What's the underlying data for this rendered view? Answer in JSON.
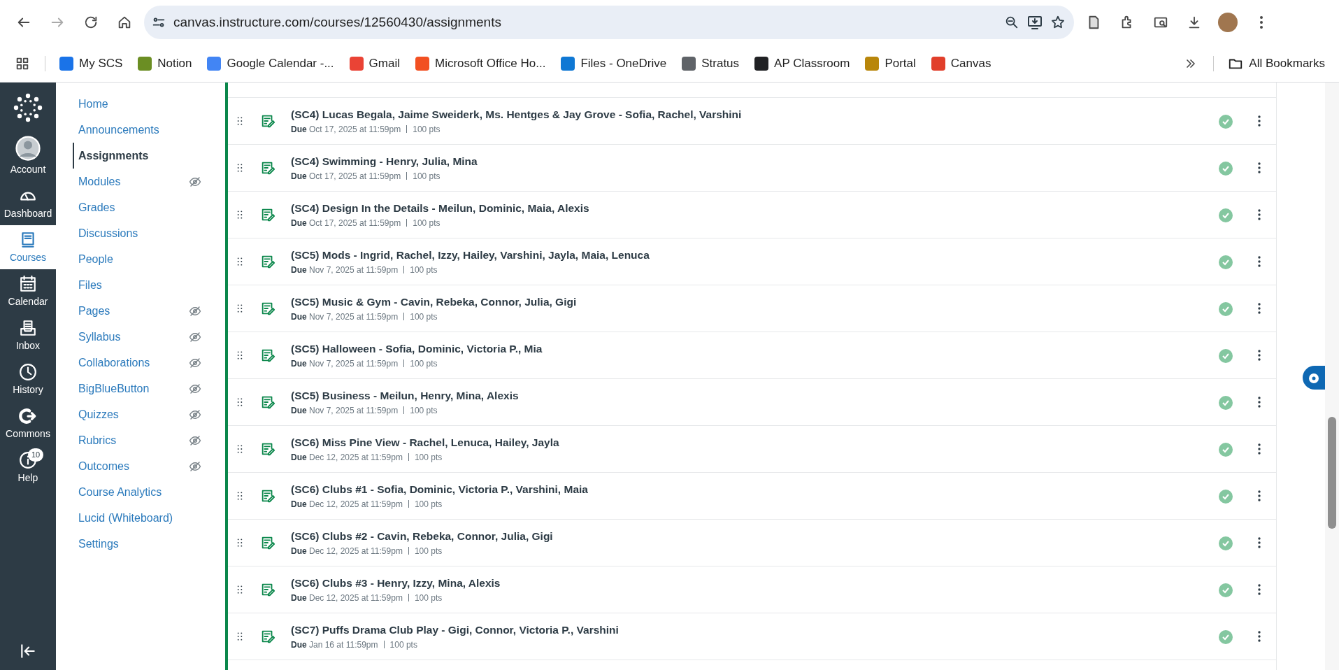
{
  "browser": {
    "url": "canvas.instructure.com/courses/12560430/assignments",
    "bookmarks": [
      {
        "label": "My SCS",
        "color": "#1a73e8"
      },
      {
        "label": "Notion",
        "color": "#6b8e23"
      },
      {
        "label": "Google Calendar -...",
        "color": "#4285f4"
      },
      {
        "label": "Gmail",
        "color": "#ea4335"
      },
      {
        "label": "Microsoft Office Ho...",
        "color": "#f25022"
      },
      {
        "label": "Files - OneDrive",
        "color": "#0f78d4"
      },
      {
        "label": "Stratus",
        "color": "#5f6368"
      },
      {
        "label": "AP Classroom",
        "color": "#202124"
      },
      {
        "label": "Portal",
        "color": "#b8860b"
      },
      {
        "label": "Canvas",
        "color": "#e13f2b"
      }
    ],
    "all_bookmarks": "All Bookmarks"
  },
  "global_nav": [
    {
      "kind": "account",
      "label": "Account",
      "selected": false
    },
    {
      "kind": "dashboard",
      "label": "Dashboard",
      "selected": false
    },
    {
      "kind": "courses",
      "label": "Courses",
      "selected": true
    },
    {
      "kind": "calendar",
      "label": "Calendar",
      "selected": false
    },
    {
      "kind": "inbox",
      "label": "Inbox",
      "selected": false
    },
    {
      "kind": "history",
      "label": "History",
      "selected": false
    },
    {
      "kind": "commons",
      "label": "Commons",
      "selected": false
    },
    {
      "kind": "help",
      "label": "Help",
      "selected": false,
      "badge": "10"
    }
  ],
  "course_nav": [
    {
      "label": "Home",
      "selected": false,
      "hidden": false
    },
    {
      "label": "Announcements",
      "selected": false,
      "hidden": false
    },
    {
      "label": "Assignments",
      "selected": true,
      "hidden": false
    },
    {
      "label": "Modules",
      "selected": false,
      "hidden": true
    },
    {
      "label": "Grades",
      "selected": false,
      "hidden": false
    },
    {
      "label": "Discussions",
      "selected": false,
      "hidden": false
    },
    {
      "label": "People",
      "selected": false,
      "hidden": false
    },
    {
      "label": "Files",
      "selected": false,
      "hidden": false
    },
    {
      "label": "Pages",
      "selected": false,
      "hidden": true
    },
    {
      "label": "Syllabus",
      "selected": false,
      "hidden": true
    },
    {
      "label": "Collaborations",
      "selected": false,
      "hidden": true
    },
    {
      "label": "BigBlueButton",
      "selected": false,
      "hidden": true
    },
    {
      "label": "Quizzes",
      "selected": false,
      "hidden": true
    },
    {
      "label": "Rubrics",
      "selected": false,
      "hidden": true
    },
    {
      "label": "Outcomes",
      "selected": false,
      "hidden": true
    },
    {
      "label": "Course Analytics",
      "selected": false,
      "hidden": false
    },
    {
      "label": "Lucid (Whiteboard)",
      "selected": false,
      "hidden": false
    },
    {
      "label": "Settings",
      "selected": false,
      "hidden": false
    }
  ],
  "assignments": [
    {
      "title": "(SC4) Lucas Begala, Jaime Sweiderk, Ms. Hentges & Jay Grove - Sofia, Rachel, Varshini",
      "due_label": "Due",
      "due": "Oct 17, 2025 at 11:59pm",
      "points": "100 pts",
      "published": true
    },
    {
      "title": "(SC4) Swimming - Henry, Julia, Mina",
      "due_label": "Due",
      "due": "Oct 17, 2025 at 11:59pm",
      "points": "100 pts",
      "published": true
    },
    {
      "title": "(SC4) Design In the Details - Meilun, Dominic, Maia, Alexis",
      "due_label": "Due",
      "due": "Oct 17, 2025 at 11:59pm",
      "points": "100 pts",
      "published": true
    },
    {
      "title": "(SC5) Mods - Ingrid, Rachel, Izzy, Hailey, Varshini, Jayla, Maia, Lenuca",
      "due_label": "Due",
      "due": "Nov 7, 2025 at 11:59pm",
      "points": "100 pts",
      "published": true
    },
    {
      "title": "(SC5) Music & Gym - Cavin, Rebeka, Connor, Julia, Gigi",
      "due_label": "Due",
      "due": "Nov 7, 2025 at 11:59pm",
      "points": "100 pts",
      "published": true
    },
    {
      "title": "(SC5) Halloween - Sofia, Dominic, Victoria P., Mia",
      "due_label": "Due",
      "due": "Nov 7, 2025 at 11:59pm",
      "points": "100 pts",
      "published": true
    },
    {
      "title": "(SC5) Business - Meilun, Henry, Mina, Alexis",
      "due_label": "Due",
      "due": "Nov 7, 2025 at 11:59pm",
      "points": "100 pts",
      "published": true
    },
    {
      "title": "(SC6) Miss Pine View - Rachel, Lenuca, Hailey, Jayla",
      "due_label": "Due",
      "due": "Dec 12, 2025 at 11:59pm",
      "points": "100 pts",
      "published": true
    },
    {
      "title": "(SC6) Clubs #1 - Sofia, Dominic, Victoria P., Varshini, Maia",
      "due_label": "Due",
      "due": "Dec 12, 2025 at 11:59pm",
      "points": "100 pts",
      "published": true
    },
    {
      "title": "(SC6) Clubs #2 - Cavin, Rebeka, Connor, Julia, Gigi",
      "due_label": "Due",
      "due": "Dec 12, 2025 at 11:59pm",
      "points": "100 pts",
      "published": true
    },
    {
      "title": "(SC6) Clubs #3 - Henry, Izzy, Mina, Alexis",
      "due_label": "Due",
      "due": "Dec 12, 2025 at 11:59pm",
      "points": "100 pts",
      "published": true
    },
    {
      "title": "(SC7) Puffs Drama Club Play - Gigi, Connor, Victoria P., Varshini",
      "due_label": "Due",
      "due": "Jan 16 at 11:59pm",
      "points": "100 pts",
      "published": true
    }
  ]
}
